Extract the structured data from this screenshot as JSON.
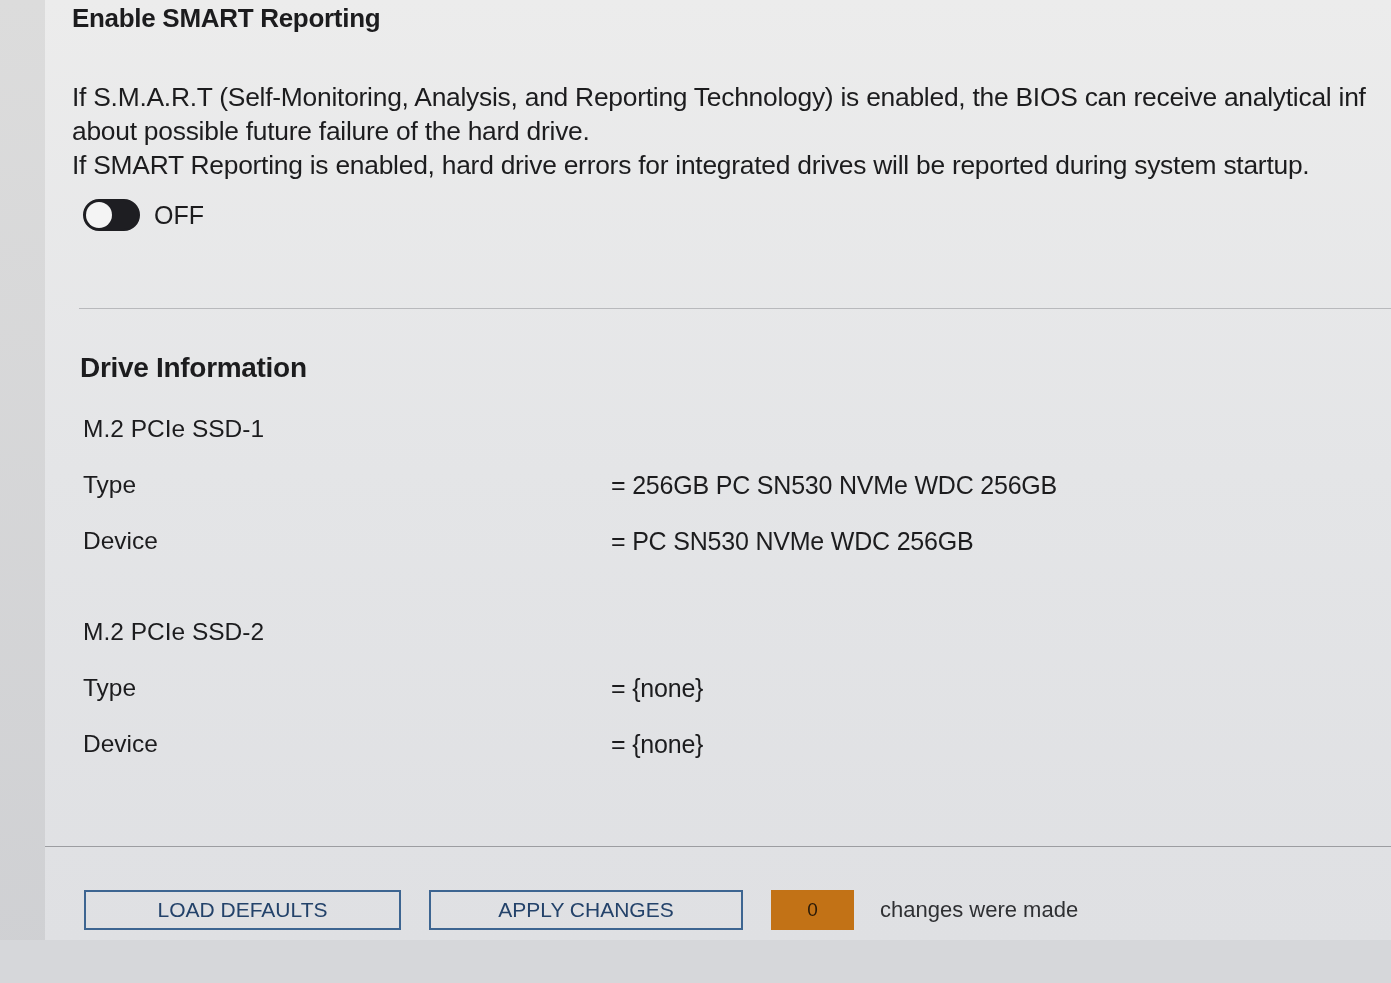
{
  "smart_reporting": {
    "title": "Enable SMART Reporting",
    "description_lines": [
      "If S.M.A.R.T (Self-Monitoring, Analysis, and Reporting Technology) is enabled, the BIOS can receive analytical inf",
      "about possible future failure of the hard drive.",
      "If SMART Reporting is enabled, hard drive errors for integrated drives will be reported during system startup."
    ],
    "toggle": {
      "on": false,
      "label": "OFF"
    }
  },
  "drive_information": {
    "title": "Drive Information",
    "drives": [
      {
        "name": "M.2 PCIe SSD-1",
        "fields": [
          {
            "label": "Type",
            "value": "= 256GB PC SN530 NVMe WDC 256GB"
          },
          {
            "label": "Device",
            "value": "= PC SN530 NVMe WDC 256GB"
          }
        ]
      },
      {
        "name": "M.2 PCIe SSD-2",
        "fields": [
          {
            "label": "Type",
            "value": "= {none}"
          },
          {
            "label": "Device",
            "value": "= {none}"
          }
        ]
      }
    ]
  },
  "footer": {
    "buttons": [
      "LOAD DEFAULTS",
      "APPLY CHANGES"
    ],
    "change_count": "0",
    "change_text": "changes were made"
  }
}
